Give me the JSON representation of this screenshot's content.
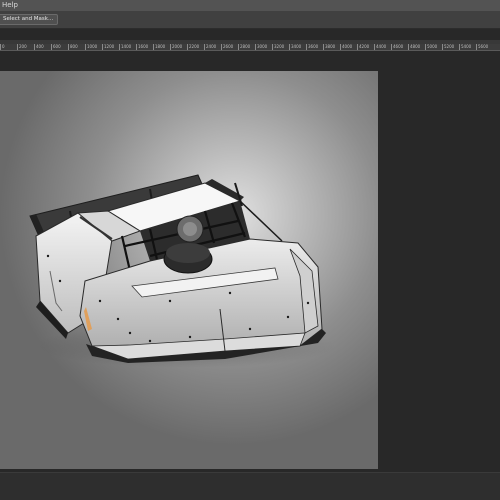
{
  "menubar": {
    "visible_item": "Help"
  },
  "options_bar": {
    "select_and_mask_label": "Select and Mask..."
  },
  "ruler": {
    "labels": [
      "0",
      "200",
      "400",
      "600",
      "800",
      "1000",
      "1200",
      "1400",
      "1600",
      "1800",
      "2000",
      "2200",
      "2400",
      "2600",
      "2800",
      "3000",
      "3200",
      "3400",
      "3600",
      "3800",
      "4000",
      "4200",
      "4400",
      "4600",
      "4800",
      "5000",
      "5200",
      "5400",
      "5600"
    ]
  },
  "colors": {
    "menubar": "#535353",
    "options_bar": "#404040",
    "workspace": "#282828",
    "document_center": "#e0e0e0",
    "document_edge": "#6a6a6a"
  },
  "document": {
    "content": "race-car-illustration"
  }
}
